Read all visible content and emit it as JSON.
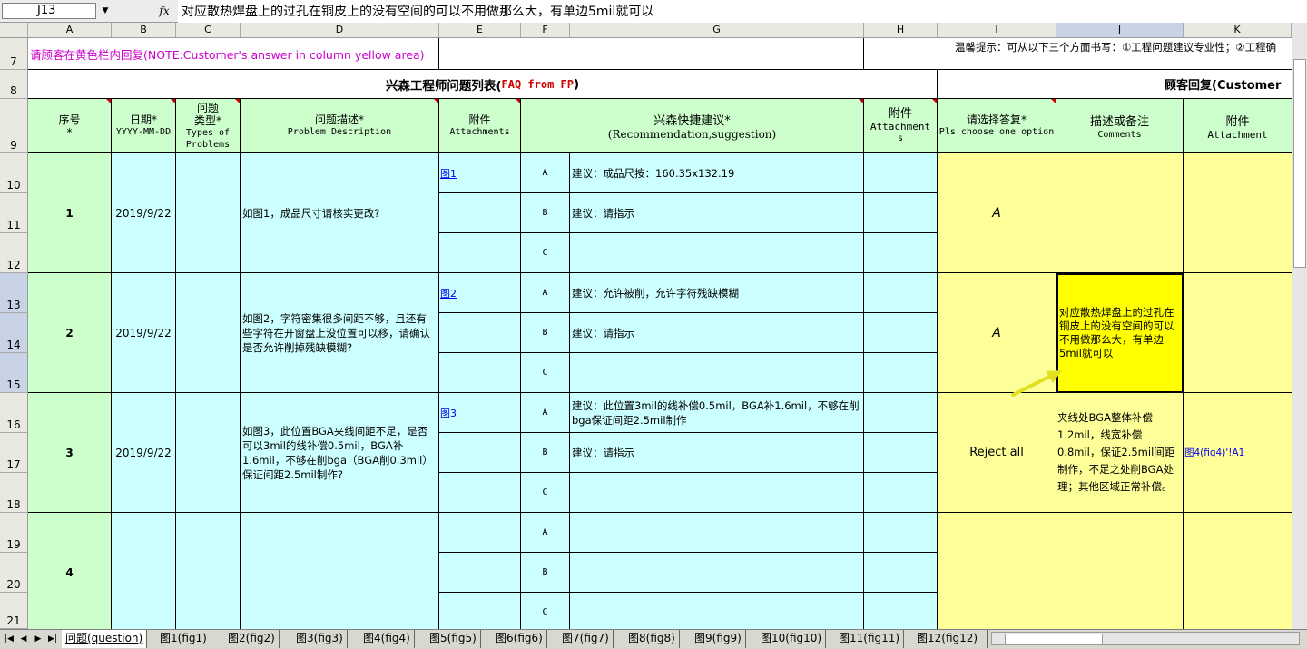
{
  "formula_bar": {
    "cell_ref": "J13",
    "fx_label": "fx",
    "content": "对应散热焊盘上的过孔在铜皮上的没有空间的可以不用做那么大，有单边5mil就可以"
  },
  "columns": [
    "A",
    "B",
    "C",
    "D",
    "E",
    "F",
    "G",
    "H",
    "I",
    "J",
    "K"
  ],
  "rows": [
    "7",
    "8",
    "9",
    "10",
    "11",
    "12",
    "13",
    "14",
    "15",
    "16",
    "17",
    "18",
    "19",
    "20",
    "21"
  ],
  "note_row": {
    "customer_note": "请顾客在黄色栏内回复(NOTE:Customer's answer in column yellow area)",
    "tip": "温馨提示：可从以下三个方面书写：①工程问题建议专业性；②工程确"
  },
  "section_titles": {
    "left_prefix": "兴森工程师问题列表(",
    "left_en": "FAQ from FP",
    "left_suffix": ")",
    "right": "顾客回复(Customer"
  },
  "headers": {
    "seq": [
      "序号",
      "*"
    ],
    "date": [
      "日期*",
      "YYYY-MM-DD"
    ],
    "type": [
      "问题",
      "类型*",
      "Types of",
      "Problems"
    ],
    "desc": [
      "问题描述*",
      "Problem Description"
    ],
    "attach": [
      "附件",
      "Attachments"
    ],
    "suggest": [
      "兴森快捷建议*",
      "(Recommendation,suggestion)"
    ],
    "attach_h": [
      "附件",
      "Attachment",
      "s"
    ],
    "choose": [
      "请选择答复*",
      "Pls choose one option"
    ],
    "comments": [
      "描述或备注",
      "Comments"
    ],
    "attach_k": [
      "附件",
      "Attachment"
    ]
  },
  "problems": [
    {
      "no": "1",
      "date": "2019/9/22",
      "desc": "如图1，成品尺寸请核实更改?",
      "fig_link": "图1",
      "options": [
        {
          "key": "A",
          "text": "建议：成品尺按：160.35x132.19"
        },
        {
          "key": "B",
          "text": "建议：请指示"
        },
        {
          "key": "C",
          "text": ""
        }
      ],
      "answer": "A",
      "comment": "",
      "attach": ""
    },
    {
      "no": "2",
      "date": "2019/9/22",
      "desc": "如图2，字符密集很多间距不够，且还有些字符在开窗盘上没位置可以移，请确认是否允许削掉残缺模糊?",
      "fig_link": "图2",
      "options": [
        {
          "key": "A",
          "text": "建议：允许被削，允许字符残缺模糊"
        },
        {
          "key": "B",
          "text": "建议：请指示"
        },
        {
          "key": "C",
          "text": ""
        }
      ],
      "answer": "A",
      "comment": "对应散热焊盘上的过孔在铜皮上的没有空间的可以不用做那么大，有单边5mil就可以",
      "attach": ""
    },
    {
      "no": "3",
      "date": "2019/9/22",
      "desc": "如图3，此位置BGA夹线间距不足，是否可以3mil的线补偿0.5mil，BGA补1.6mil，不够在削bga（BGA削0.3mil）保证间距2.5mil制作?",
      "fig_link": "图3",
      "options": [
        {
          "key": "A",
          "text": "建议：此位置3mil的线补偿0.5mil，BGA补1.6mil，不够在削bga保证间距2.5mil制作"
        },
        {
          "key": "B",
          "text": "建议：请指示"
        },
        {
          "key": "C",
          "text": ""
        }
      ],
      "answer": "Reject all",
      "comment": "夹线处BGA整体补偿1.2mil，线宽补偿0.8mil，保证2.5mil间距制作，不足之处削BGA处理；其他区域正常补偿。",
      "attach": "图4(fig4)'!A1"
    },
    {
      "no": "4",
      "date": "",
      "desc": "",
      "fig_link": "",
      "options": [
        {
          "key": "A",
          "text": ""
        },
        {
          "key": "B",
          "text": ""
        },
        {
          "key": "C",
          "text": ""
        }
      ],
      "answer": "",
      "comment": "",
      "attach": ""
    }
  ],
  "sheet_tabs": [
    "问题(question)",
    "图1(fig1)",
    "图2(fig2)",
    "图3(fig3)",
    "图4(fig4)",
    "图5(fig5)",
    "图6(fig6)",
    "图7(fig7)",
    "图8(fig8)",
    "图9(fig9)",
    "图10(fig10)",
    "图11(fig11)",
    "图12(fig12)"
  ],
  "colors": {
    "green": "#ccffcc",
    "cyan": "#ccffff",
    "yellow": "#ffff99",
    "selected": "#ffff00",
    "link": "#0000ee"
  }
}
